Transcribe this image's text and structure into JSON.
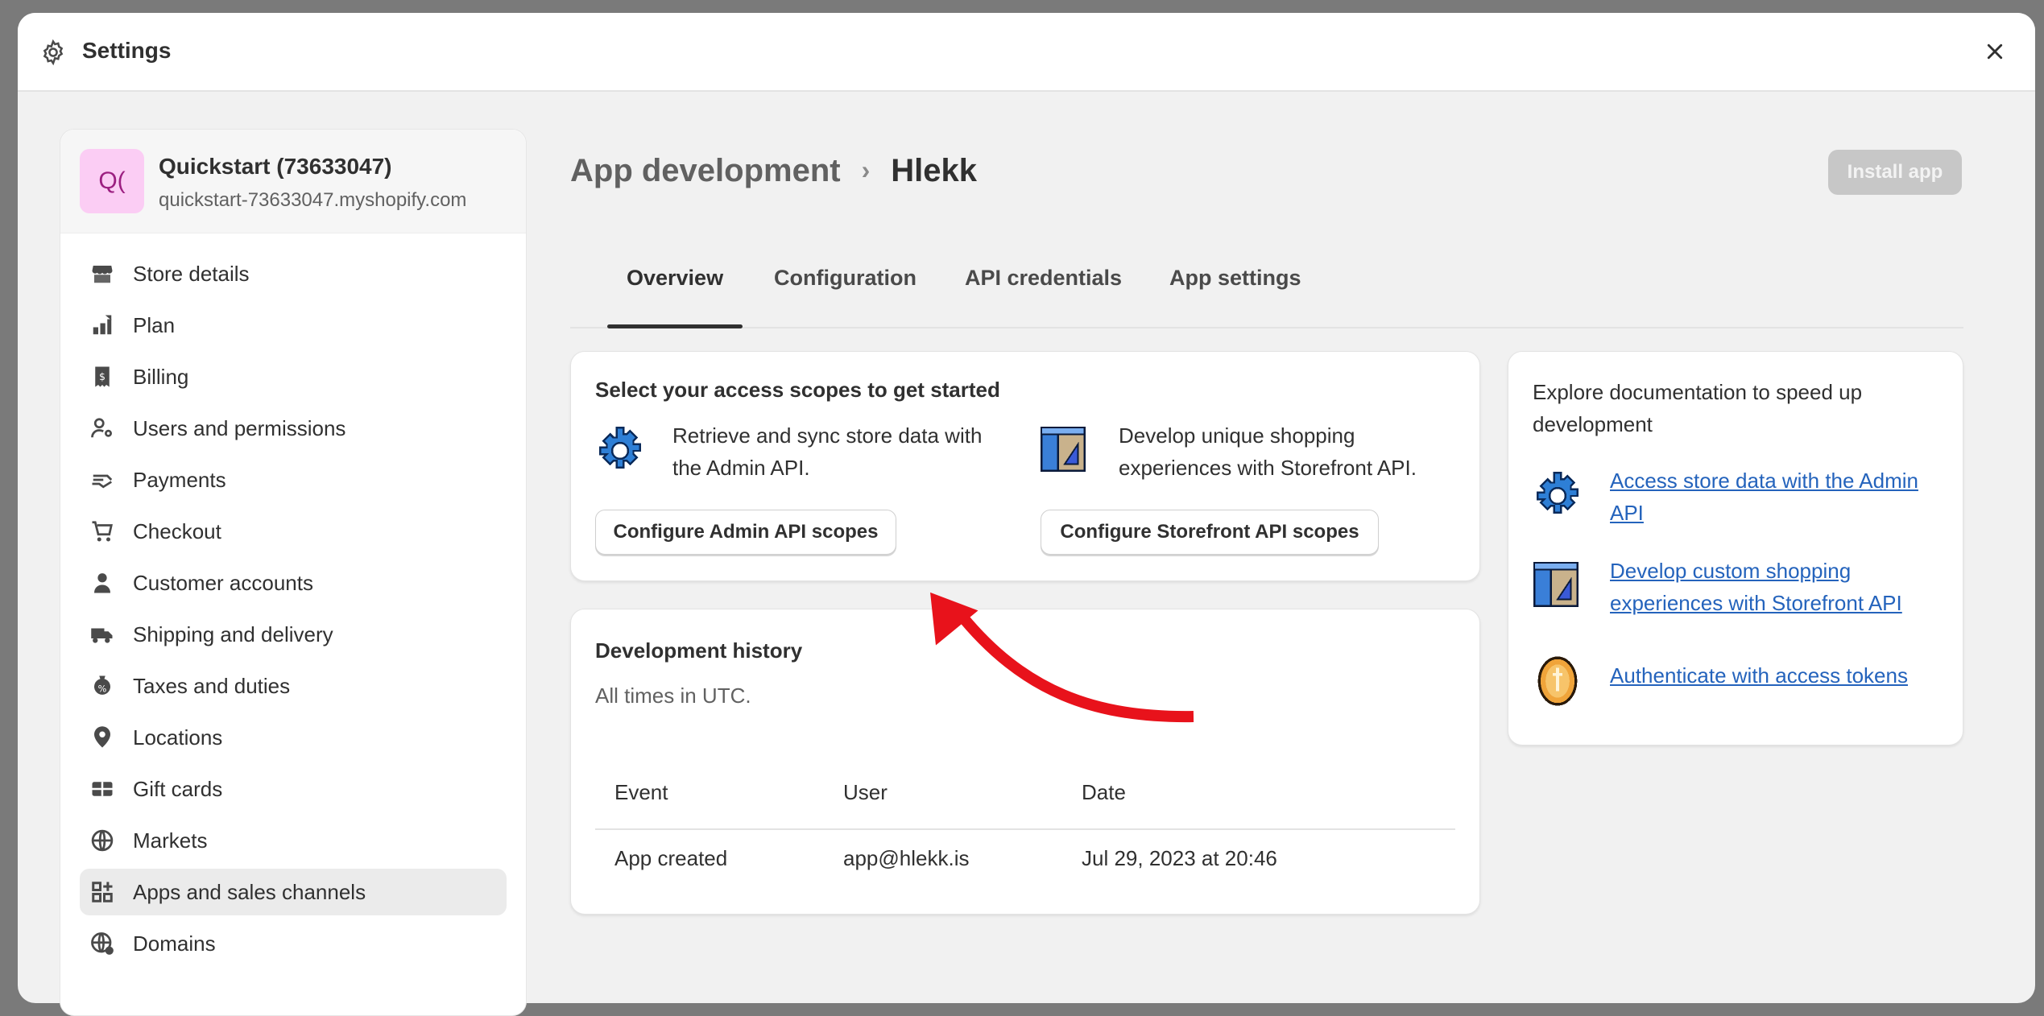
{
  "modal": {
    "title": "Settings"
  },
  "store": {
    "avatar_initials": "Q(",
    "name": "Quickstart (73633047)",
    "domain": "quickstart-73633047.myshopify.com"
  },
  "sidebar": {
    "items": [
      {
        "label": "Store details",
        "icon": "store-icon"
      },
      {
        "label": "Plan",
        "icon": "plan-icon"
      },
      {
        "label": "Billing",
        "icon": "billing-icon"
      },
      {
        "label": "Users and permissions",
        "icon": "users-icon"
      },
      {
        "label": "Payments",
        "icon": "payments-icon"
      },
      {
        "label": "Checkout",
        "icon": "cart-icon"
      },
      {
        "label": "Customer accounts",
        "icon": "person-icon"
      },
      {
        "label": "Shipping and delivery",
        "icon": "truck-icon"
      },
      {
        "label": "Taxes and duties",
        "icon": "taxes-icon"
      },
      {
        "label": "Locations",
        "icon": "location-icon"
      },
      {
        "label": "Gift cards",
        "icon": "gift-card-icon"
      },
      {
        "label": "Markets",
        "icon": "globe-icon"
      },
      {
        "label": "Apps and sales channels",
        "icon": "apps-icon",
        "active": true
      },
      {
        "label": "Domains",
        "icon": "domain-icon"
      }
    ]
  },
  "breadcrumb": {
    "parent": "App development",
    "separator": "›",
    "current": "Hlekk"
  },
  "header": {
    "install_label": "Install app"
  },
  "tabs": [
    {
      "label": "Overview",
      "active": true
    },
    {
      "label": "Configuration"
    },
    {
      "label": "API credentials"
    },
    {
      "label": "App settings"
    }
  ],
  "scopes_card": {
    "title": "Select your access scopes to get started",
    "admin_text": "Retrieve and sync store data with the Admin API.",
    "admin_button": "Configure Admin API scopes",
    "storefront_text": "Develop unique shopping experiences with Storefront API.",
    "storefront_button": "Configure Storefront API scopes"
  },
  "history_card": {
    "title": "Development history",
    "subtitle": "All times in UTC.",
    "columns": [
      "Event",
      "User",
      "Date"
    ],
    "rows": [
      {
        "event": "App created",
        "user": "app@hlekk.is",
        "date": "Jul 29, 2023 at 20:46"
      }
    ]
  },
  "docs_card": {
    "intro": "Explore documentation to speed up development",
    "links": [
      {
        "label": "Access store data with the Admin API",
        "icon": "gear-pixel-icon"
      },
      {
        "label": "Develop custom shopping experiences with Storefront API",
        "icon": "tools-pixel-icon"
      },
      {
        "label": "Authenticate with access tokens",
        "icon": "coin-pixel-icon"
      }
    ]
  },
  "colors": {
    "link": "#2463bc",
    "arrow": "#e8121b",
    "avatar_bg": "#fbcdf4"
  }
}
